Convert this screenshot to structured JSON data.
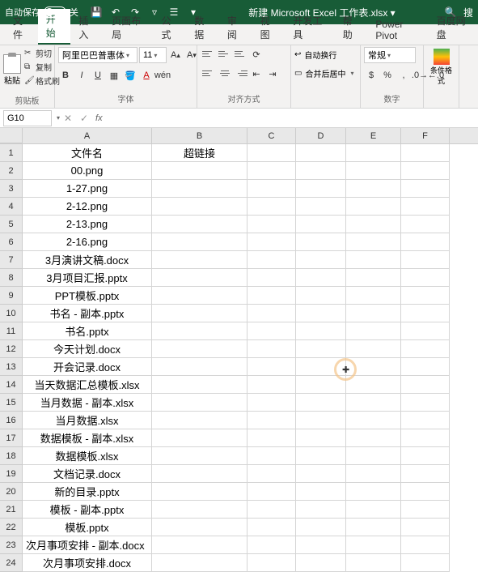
{
  "titlebar": {
    "autosave_label": "自动保存",
    "autosave_state": "关",
    "doc_title": "新建 Microsoft Excel 工作表.xlsx ▾",
    "search_placeholder": "搜"
  },
  "tabs": [
    "文件",
    "开始",
    "插入",
    "页面布局",
    "公式",
    "数据",
    "审阅",
    "视图",
    "开发工具",
    "帮助",
    "Power Pivot",
    "百度网盘"
  ],
  "active_tab": 1,
  "ribbon": {
    "clipboard": {
      "paste": "粘贴",
      "cut": "剪切",
      "copy": "复制",
      "format_painter": "格式刷",
      "group_label": "剪贴板"
    },
    "font": {
      "name": "阿里巴巴普惠体",
      "size": "11",
      "group_label": "字体"
    },
    "alignment": {
      "wrap": "自动换行",
      "merge": "合并后居中",
      "group_label": "对齐方式"
    },
    "number": {
      "format": "常规",
      "group_label": "数字"
    },
    "cond": {
      "label": "条件格式"
    }
  },
  "formula_bar": {
    "name_box": "G10",
    "formula": ""
  },
  "columns": [
    "A",
    "B",
    "C",
    "D",
    "E",
    "F"
  ],
  "chart_data": {
    "type": "table",
    "headers": [
      "文件名",
      "超链接"
    ],
    "rows": [
      [
        "文件名",
        "超链接"
      ],
      [
        "00.png",
        ""
      ],
      [
        "1-27.png",
        ""
      ],
      [
        "2-12.png",
        ""
      ],
      [
        "2-13.png",
        ""
      ],
      [
        "2-16.png",
        ""
      ],
      [
        "3月演讲文稿.docx",
        ""
      ],
      [
        "3月项目汇报.pptx",
        ""
      ],
      [
        "PPT模板.pptx",
        ""
      ],
      [
        "书名 - 副本.pptx",
        ""
      ],
      [
        "书名.pptx",
        ""
      ],
      [
        "今天计划.docx",
        ""
      ],
      [
        "开会记录.docx",
        ""
      ],
      [
        "当天数据汇总模板.xlsx",
        ""
      ],
      [
        "当月数据 - 副本.xlsx",
        ""
      ],
      [
        "当月数据.xlsx",
        ""
      ],
      [
        "数据模板 - 副本.xlsx",
        ""
      ],
      [
        "数据模板.xlsx",
        ""
      ],
      [
        "文档记录.docx",
        ""
      ],
      [
        "新的目录.pptx",
        ""
      ],
      [
        "模板 - 副本.pptx",
        ""
      ],
      [
        "模板.pptx",
        ""
      ],
      [
        "次月事项安排 - 副本.docx",
        ""
      ],
      [
        "次月事项安排.docx",
        ""
      ]
    ]
  },
  "cursor": {
    "row": 12,
    "col": "D"
  }
}
